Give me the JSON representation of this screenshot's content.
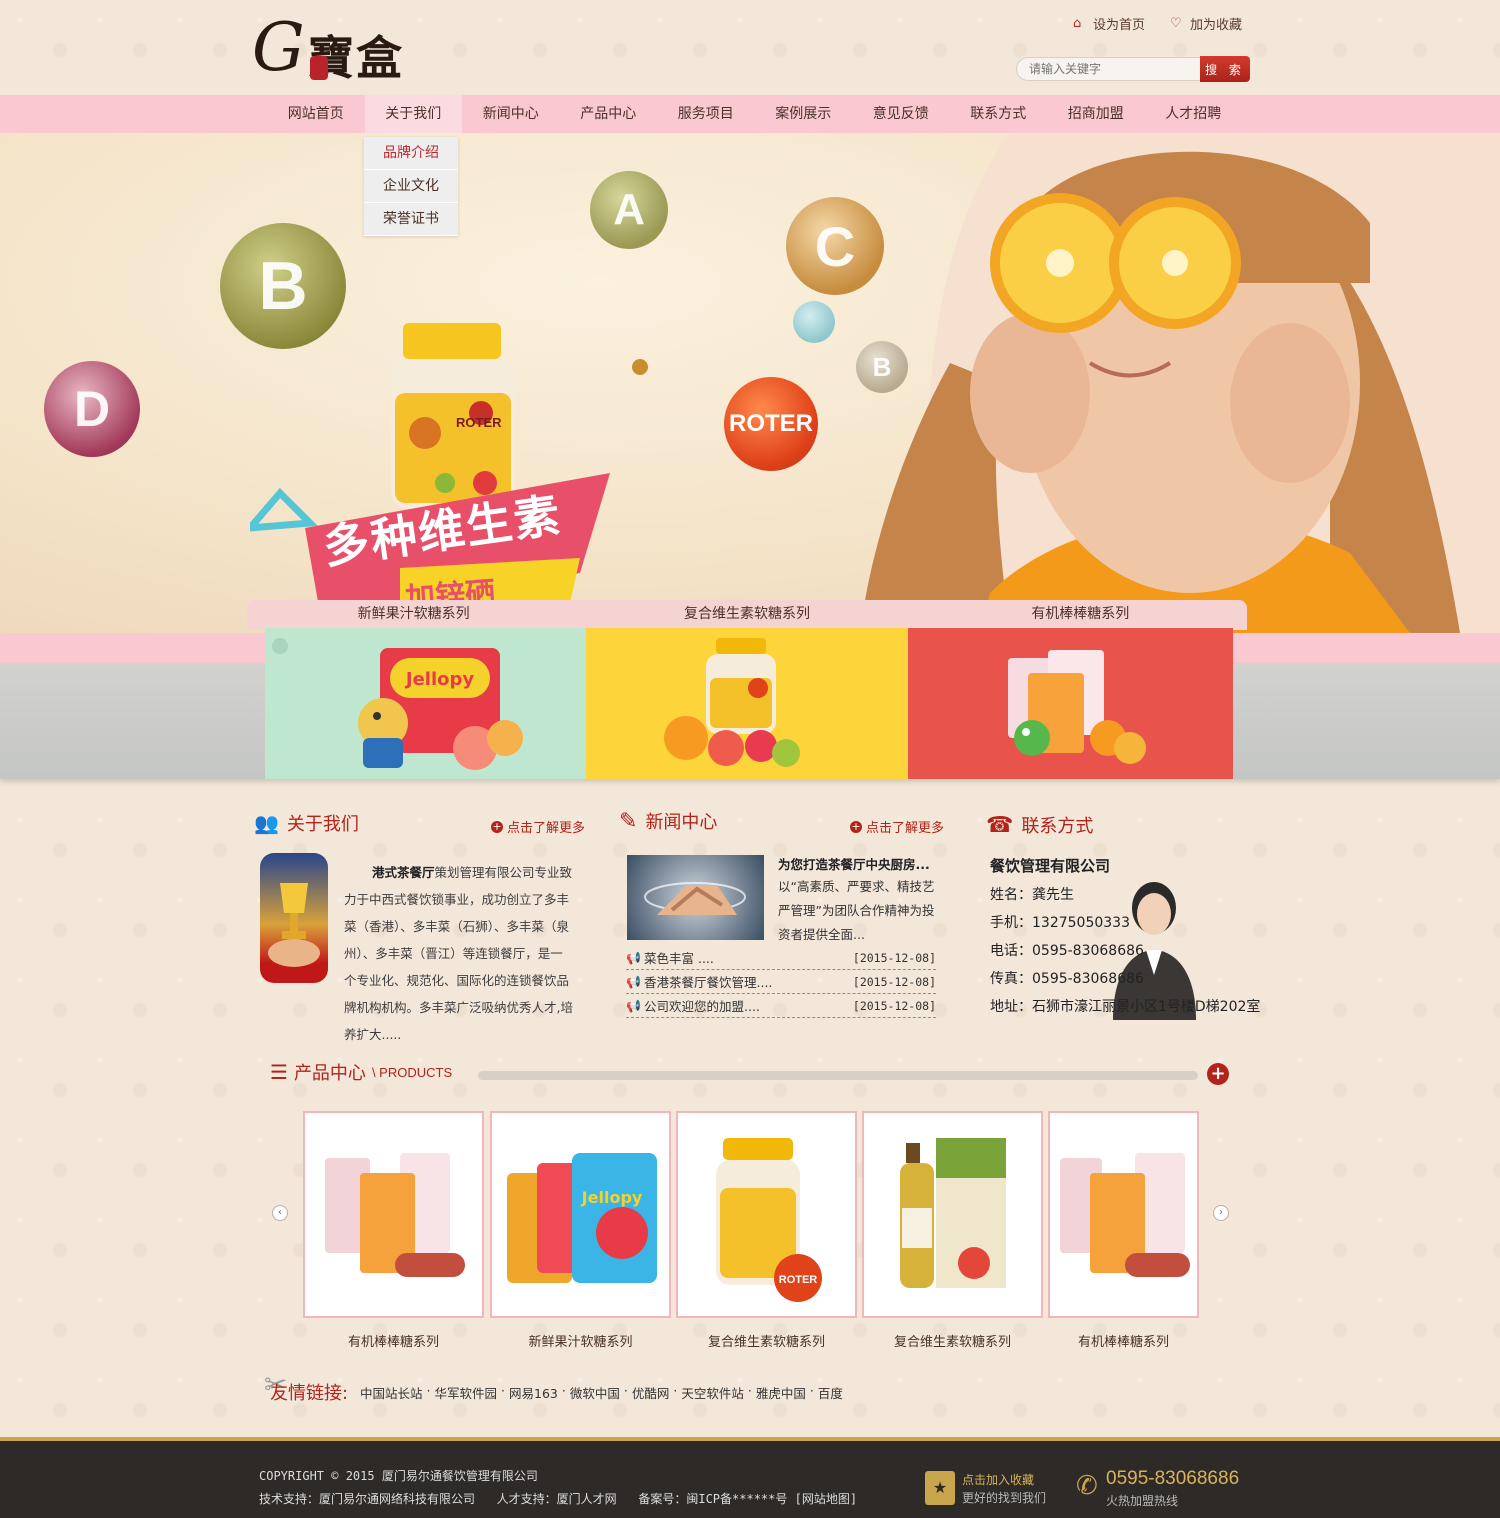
{
  "header": {
    "set_home": "设为首页",
    "add_favorite": "加为收藏",
    "search_placeholder": "请输入关键字",
    "search_button": "搜 索"
  },
  "nav": {
    "items": [
      "网站首页",
      "关于我们",
      "新闻中心",
      "产品中心",
      "服务项目",
      "案例展示",
      "意见反馈",
      "联系方式",
      "招商加盟",
      "人才招聘"
    ],
    "active_index": 1,
    "submenu": [
      "品牌介绍",
      "企业文化",
      "荣誉证书"
    ]
  },
  "banner": {
    "headline": "多种维生素",
    "sub_headline": "加锌硒",
    "brand": "ROTER",
    "vitamins": [
      "A",
      "B",
      "C",
      "D",
      "B"
    ]
  },
  "categories": [
    "新鲜果汁软糖系列",
    "复合维生素软糖系列",
    "有机棒棒糖系列"
  ],
  "about": {
    "title": "关于我们",
    "more": "点击了解更多",
    "company": "港式茶餐厅",
    "text": "策划管理有限公司专业致力于中西式餐饮锁事业，成功创立了多丰菜（香港）、多丰菜（石狮）、多丰菜（泉州）、多丰菜（晋江）等连锁餐厅，是一个专业化、规范化、国际化的连锁餐饮品牌机构机构。多丰菜广泛吸纳优秀人才,培养扩大....."
  },
  "news": {
    "title": "新闻中心",
    "more": "点击了解更多",
    "featured_title": "为您打造茶餐厅中央厨房...",
    "featured_text": "以“高素质、严要求、精技艺严管理”为团队合作精神为投资者提供全面...",
    "items": [
      {
        "title": "菜色丰富   ....",
        "date": "[2015-12-08]"
      },
      {
        "title": "香港茶餐厅餐饮管理....",
        "date": "[2015-12-08]"
      },
      {
        "title": "公司欢迎您的加盟....",
        "date": "[2015-12-08]"
      }
    ]
  },
  "contact": {
    "title": "联系方式",
    "company": "餐饮管理有限公司",
    "lines": [
      "姓名：龚先生",
      "手机：13275050333",
      "电话：0595-83068686",
      "传真：0595-83068686",
      "地址：石狮市濠江丽景小区1号楼D梯202室"
    ]
  },
  "products": {
    "title": "产品中心",
    "subtitle": "\\ PRODUCTS",
    "items": [
      "有机棒棒糖系列",
      "新鲜果汁软糖系列",
      "复合维生素软糖系列",
      "复合维生素软糖系列",
      "有机棒棒糖系列"
    ]
  },
  "links": {
    "title": "友情链接:",
    "items": [
      "中国站长站",
      "华军软件园",
      "网易163",
      "微软中国",
      "优酷网",
      "天空软件站",
      "雅虎中国",
      "百度"
    ]
  },
  "footer": {
    "copyright": "COPYRIGHT © 2015 厦门易尔通餐饮管理有限公司",
    "support": "技术支持：厦门易尔通网络科技有限公司   人才支持：厦门人才网   备案号：闽ICP备******号 [网站地图]",
    "join_title": "点击加入收藏",
    "join_sub": "更好的找到我们",
    "hotline": "0595-83068686",
    "hotline_sub": "火热加盟热线"
  },
  "colors": {
    "accent": "#b3231a",
    "nav_pink": "#f9c8d0",
    "footer_gold": "#c9a64b"
  }
}
